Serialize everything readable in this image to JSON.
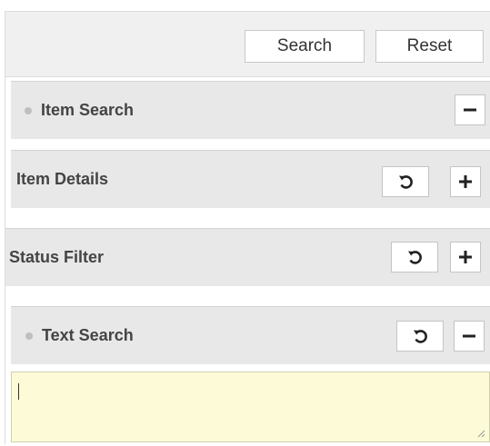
{
  "toolbar": {
    "search_label": "Search",
    "reset_label": "Reset"
  },
  "sections": [
    {
      "title": "Item Search",
      "expanded": true,
      "has_dot": true,
      "actions": [
        "minus-icon"
      ]
    },
    {
      "title": "Item Details",
      "expanded": false,
      "has_dot": false,
      "actions": [
        "refresh-icon",
        "plus-icon"
      ]
    },
    {
      "title": "Status Filter",
      "expanded": false,
      "has_dot": false,
      "actions": [
        "refresh-icon",
        "plus-icon"
      ]
    },
    {
      "title": "Text Search",
      "expanded": true,
      "has_dot": true,
      "actions": [
        "refresh-icon",
        "minus-icon"
      ]
    }
  ],
  "text_search": {
    "value": "",
    "placeholder": ""
  },
  "colors": {
    "section_bg": "#e8e8e8",
    "toolbar_bg": "#f0f0f0",
    "textarea_bg": "#fdfbd7"
  }
}
